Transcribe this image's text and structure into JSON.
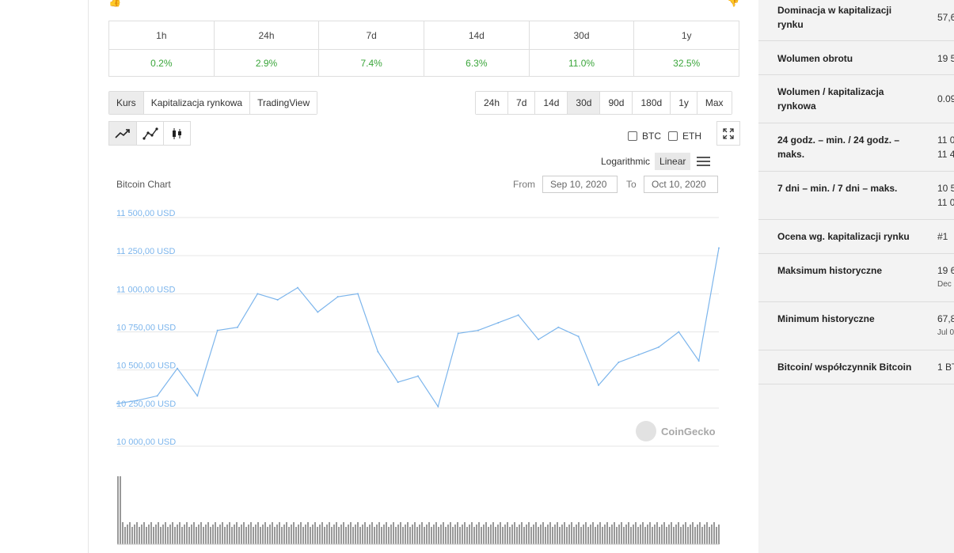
{
  "performance": {
    "headers": [
      "1h",
      "24h",
      "7d",
      "14d",
      "30d",
      "1y"
    ],
    "values": [
      "0.2%",
      "2.9%",
      "7.4%",
      "6.3%",
      "11.0%",
      "32.5%"
    ]
  },
  "chart_tabs": [
    "Kurs",
    "Kapitalizacja rynkowa",
    "TradingView"
  ],
  "range_tabs": [
    "24h",
    "7d",
    "14d",
    "30d",
    "90d",
    "180d",
    "1y",
    "Max"
  ],
  "active_range": "30d",
  "compare": {
    "btc": "BTC",
    "eth": "ETH"
  },
  "scale": {
    "log": "Logarithmic",
    "linear": "Linear",
    "active": "Linear"
  },
  "chart_header": {
    "title": "Bitcoin Chart",
    "from_label": "From",
    "from_date": "Sep 10, 2020",
    "to_label": "To",
    "to_date": "Oct 10, 2020"
  },
  "watermark": "CoinGecko",
  "colors": {
    "line": "#7cb5ec",
    "positive": "#3aa53a",
    "axis_label": "#7cb5ec"
  },
  "chart_data": {
    "type": "line",
    "y_ticks": [
      "11 500,00 USD",
      "11 250,00 USD",
      "11 000,00 USD",
      "10 750,00 USD",
      "10 500,00 USD",
      "10 250,00 USD",
      "10 000,00 USD"
    ],
    "ylim": [
      10000,
      11500
    ],
    "y_unit": "USD",
    "grid": true,
    "x": [
      0,
      1,
      2,
      3,
      4,
      5,
      6,
      7,
      8,
      9,
      10,
      11,
      12,
      13,
      14,
      15,
      16,
      17,
      18,
      19,
      20,
      21,
      22,
      23,
      24,
      25,
      26,
      27,
      28,
      29,
      30
    ],
    "values": [
      10280,
      10300,
      10330,
      10510,
      10330,
      10760,
      10780,
      11000,
      10960,
      11040,
      10880,
      10980,
      11000,
      10620,
      10420,
      10460,
      10260,
      10740,
      10760,
      10810,
      10860,
      10700,
      10780,
      10720,
      10400,
      10550,
      10600,
      10650,
      10750,
      10560,
      11300
    ]
  },
  "sidebar": {
    "stats": [
      {
        "label": "Dominacja w kapitalizacji rynku",
        "value": "57,6",
        "sub": ""
      },
      {
        "label": "Wolumen obrotu",
        "value": "19 5",
        "sub": ""
      },
      {
        "label": "Wolumen / kapitalizacja rynkowa",
        "value": "0.09",
        "sub": ""
      },
      {
        "label": "24 godz. – min. / 24 godz. – maks.",
        "value": "11 0",
        "value2": "11 4",
        "sub": ""
      },
      {
        "label": "7 dni – min. / 7 dni – maks.",
        "value": "10 5",
        "value2": "11 0",
        "sub": ""
      },
      {
        "label": "Ocena wg. kapitalizacji rynku",
        "value": "#1",
        "sub": ""
      },
      {
        "label": "Maksimum historyczne",
        "value": "19 6",
        "sub": "Dec"
      },
      {
        "label": "Minimum historyczne",
        "value": "67,8",
        "sub": "Jul 0"
      },
      {
        "label": "Bitcoin/ współczynnik Bitcoin",
        "value": "1 BT",
        "sub": ""
      }
    ]
  }
}
